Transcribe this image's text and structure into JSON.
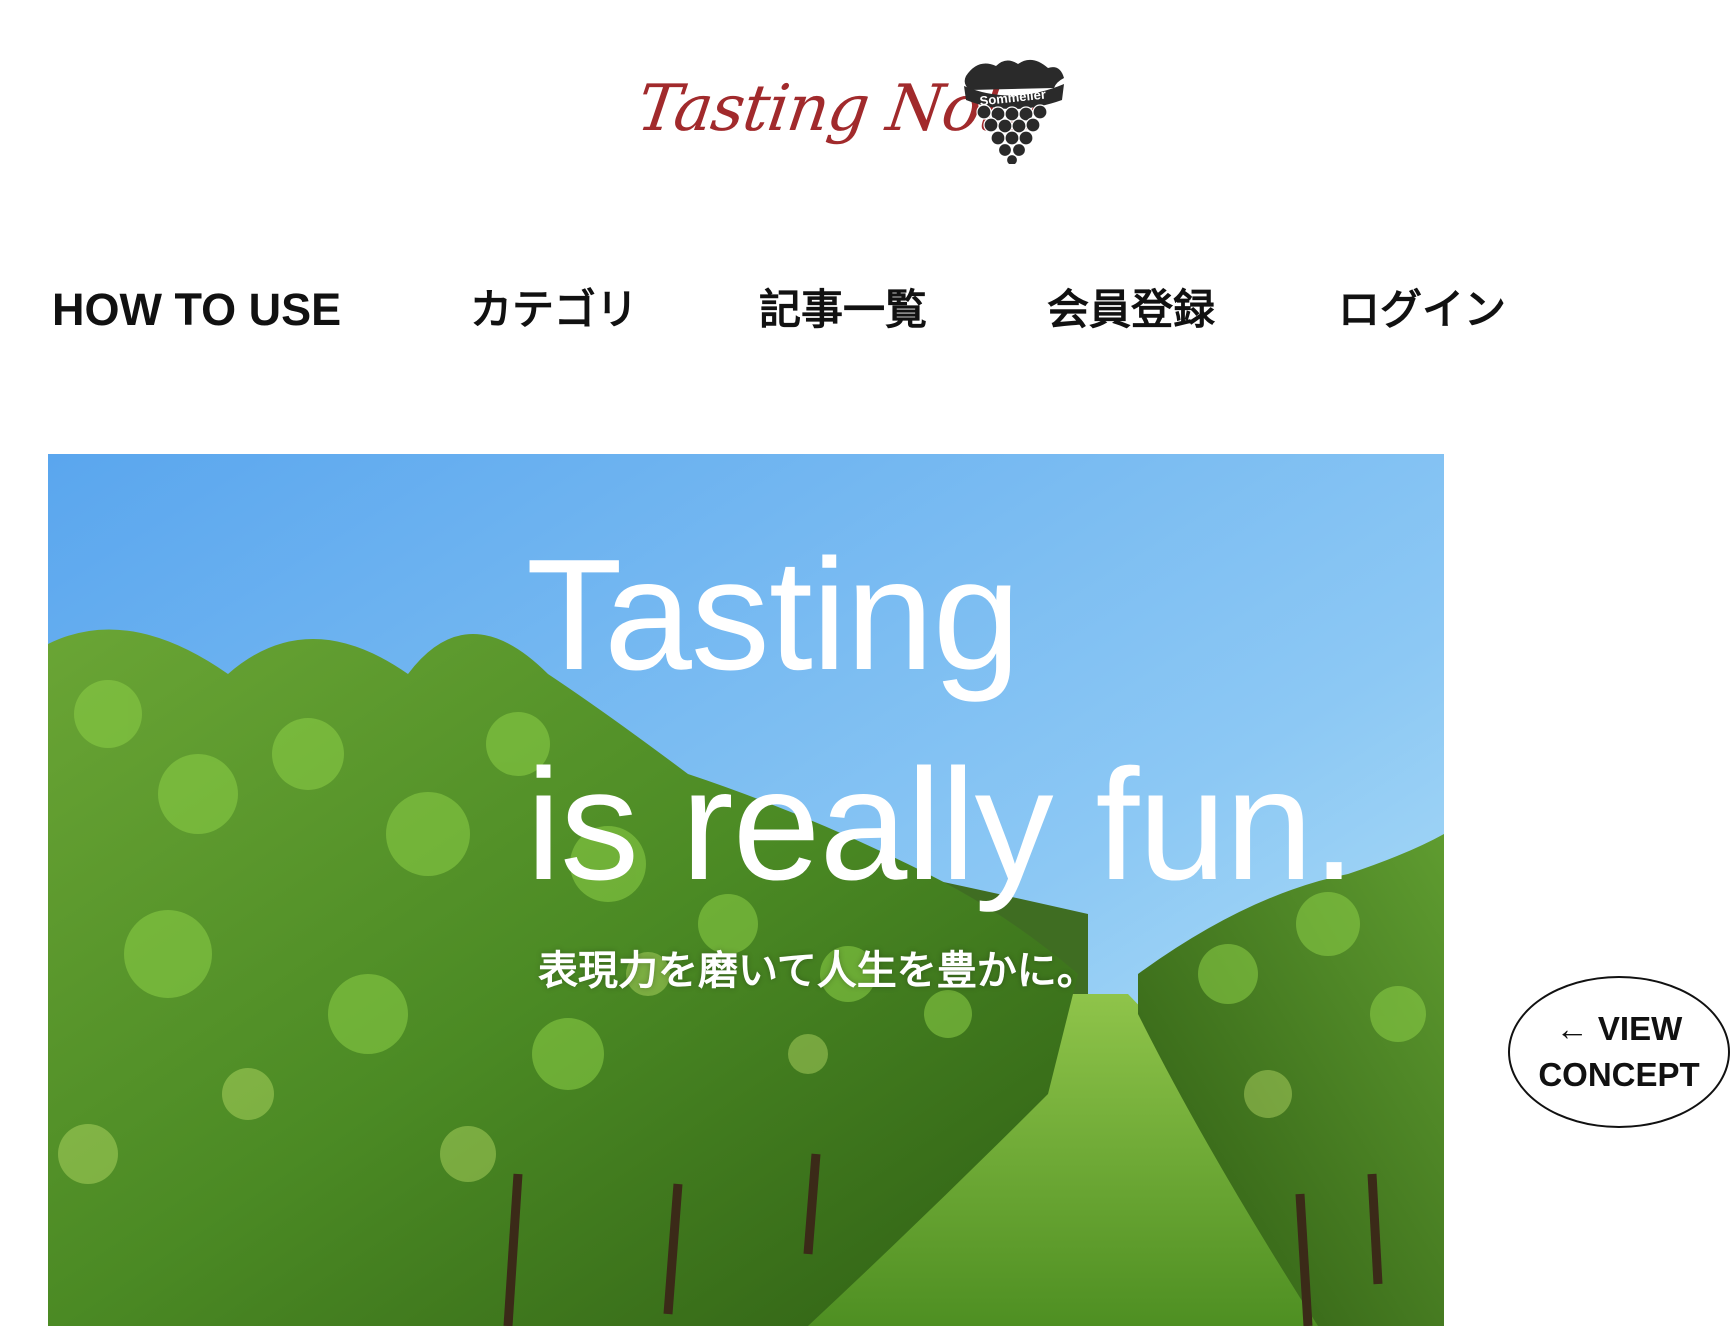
{
  "logo": {
    "text": "Tasting Note",
    "badge_text": "Sommelier",
    "brand_color": "#a12a2c",
    "icon": "grape-bunch-icon"
  },
  "nav": {
    "items": [
      {
        "label": "HOW TO USE"
      },
      {
        "label": "カテゴリ"
      },
      {
        "label": "記事一覧"
      },
      {
        "label": "会員登録"
      },
      {
        "label": "ログイン"
      }
    ]
  },
  "hero": {
    "title_line1": "Tasting",
    "title_line2": "is really fun.",
    "subtitle": "表現力を磨いて人生を豊かに。",
    "image": "vineyard-photo"
  },
  "concept_button": {
    "line1": "← VIEW",
    "line2": "CONCEPT"
  }
}
